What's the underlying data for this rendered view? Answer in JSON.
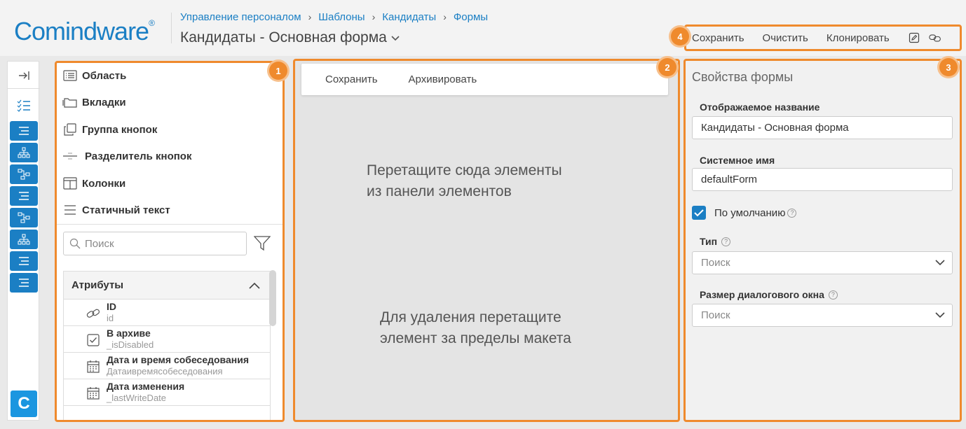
{
  "header": {
    "logo": "Comindware",
    "logo_mark": "®",
    "breadcrumbs": [
      "Управление персоналом",
      "Шаблоны",
      "Кандидаты",
      "Формы"
    ],
    "breadcrumb_separator": "›",
    "title": "Кандидаты - Основная форма"
  },
  "top_toolbar": {
    "save": "Сохранить",
    "clear": "Очистить",
    "clone": "Клонировать",
    "icons": [
      "edit-icon",
      "link-icon"
    ]
  },
  "badges": [
    "1",
    "2",
    "3",
    "4"
  ],
  "rail": {
    "items": [
      "collapse-icon",
      "checklist-icon",
      "list-icon",
      "hierarchy-icon",
      "flow-icon",
      "list-icon",
      "flow-icon",
      "hierarchy-icon",
      "list-icon",
      "list-icon"
    ],
    "bottom_logo": "C"
  },
  "elements_panel": {
    "items": [
      {
        "label": "Область",
        "icon": "list-box-icon"
      },
      {
        "label": "Вкладки",
        "icon": "folder-tabs-icon"
      },
      {
        "label": "Группа кнопок",
        "icon": "copy-buttons-icon"
      },
      {
        "label": "Разделитель кнопок",
        "icon": "separator-icon"
      },
      {
        "label": "Колонки",
        "icon": "columns-icon"
      },
      {
        "label": "Статичный текст",
        "icon": "text-lines-icon"
      }
    ],
    "search_placeholder": "Поиск",
    "attributes": {
      "header": "Атрибуты",
      "rows": [
        {
          "name": "ID",
          "system": "id",
          "icon": "link-icon"
        },
        {
          "name": "В архиве",
          "system": "_isDisabled",
          "icon": "checkbox-icon"
        },
        {
          "name": "Дата и время собеседования",
          "system": "Датаивремясобеседования",
          "icon": "calendar-icon"
        },
        {
          "name": "Дата изменения",
          "system": "_lastWriteDate",
          "icon": "calendar-icon"
        }
      ]
    }
  },
  "layout_panel": {
    "toolbar": {
      "save": "Сохранить",
      "archive": "Архивировать"
    },
    "drop_hint_line1": "Перетащите сюда элементы",
    "drop_hint_line2": "из панели элементов",
    "remove_hint_line1": "Для удаления перетащите",
    "remove_hint_line2": "элемент за пределы макета"
  },
  "properties_panel": {
    "title": "Свойства формы",
    "display_name_label": "Отображаемое название",
    "display_name_value": "Кандидаты - Основная форма",
    "system_name_label": "Системное имя",
    "system_name_value": "defaultForm",
    "default_label": "По умолчанию",
    "default_checked": true,
    "type_label": "Тип",
    "type_placeholder": "Поиск",
    "dialog_size_label": "Размер диалогового окна",
    "dialog_size_placeholder": "Поиск",
    "help_glyph": "?"
  },
  "colors": {
    "accent": "#1b7fc4",
    "highlight": "#ef8a2d",
    "background": "#e9e9e9"
  }
}
